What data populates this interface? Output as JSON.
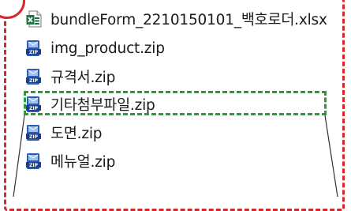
{
  "files": [
    {
      "name": "bundleForm_2210150101_백호로더.xlsx",
      "icon": "excel-file-icon"
    },
    {
      "name": "img_product.zip",
      "icon": "zip-file-icon"
    },
    {
      "name": "규격서.zip",
      "icon": "zip-file-icon"
    },
    {
      "name": "기타첨부파일.zip",
      "icon": "zip-file-icon"
    },
    {
      "name": "도면.zip",
      "icon": "zip-file-icon"
    },
    {
      "name": "메뉴얼.zip",
      "icon": "zip-file-icon"
    }
  ],
  "highlighted_index": 3,
  "colors": {
    "frame": "#d9262b",
    "highlight": "#2e9a36",
    "excel": "#1e7145",
    "zip": "#2b5cb8"
  }
}
